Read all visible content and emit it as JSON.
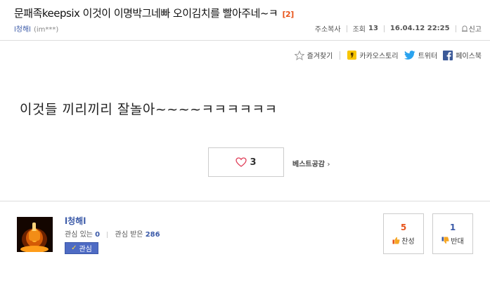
{
  "post": {
    "title": "문패족keepsix 이것이 이명박그네빠 오이김치를 빨아주네~ㅋ",
    "comment_count": "[2]",
    "author_name": "l청해l",
    "author_id_masked": "(im***)",
    "copy_address": "주소복사",
    "views_label": "조회",
    "views_count": "13",
    "date": "16.04.12 22:25",
    "report_label": "신고"
  },
  "share": {
    "bookmark_label": "즐겨찾기",
    "kakaostory_label": "카카오스토리",
    "twitter_label": "트위터",
    "facebook_label": "페이스북"
  },
  "body": {
    "text": "이것들 끼리끼리 잘놀아~~~~ㅋㅋㅋㅋㅋㅋ"
  },
  "like": {
    "count": "3",
    "best_label": "베스트공감"
  },
  "profile": {
    "name": "l청해l",
    "interest_label": "관심 있는",
    "interest_count": "0",
    "interested_by_label": "관심 받은",
    "interested_by_count": "286",
    "fav_button_label": "관심"
  },
  "votes": {
    "up_count": "5",
    "up_label": "찬성",
    "down_count": "1",
    "down_label": "반대"
  },
  "colors": {
    "accent_orange": "#e8541b",
    "link_blue": "#3b5aa8",
    "vote_up": "#e8541b",
    "vote_down": "#3b5aa8"
  }
}
